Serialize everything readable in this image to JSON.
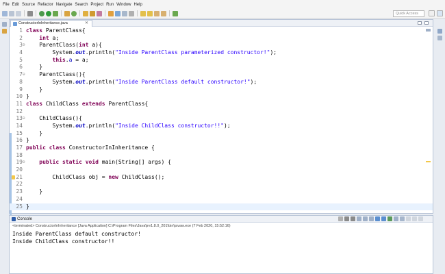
{
  "menu": [
    "File",
    "Edit",
    "Source",
    "Refactor",
    "Navigate",
    "Search",
    "Project",
    "Run",
    "Window",
    "Help"
  ],
  "toolbar": {
    "quick_access": "Quick Access"
  },
  "editor": {
    "tab_label": "ConstructorInInheritance.java",
    "lines": [
      {
        "n": "1",
        "fold": ""
      },
      {
        "n": "2",
        "fold": ""
      },
      {
        "n": "3",
        "fold": "⊖"
      },
      {
        "n": "4",
        "fold": ""
      },
      {
        "n": "5",
        "fold": ""
      },
      {
        "n": "6",
        "fold": ""
      },
      {
        "n": "7",
        "fold": "⊖"
      },
      {
        "n": "8",
        "fold": ""
      },
      {
        "n": "9",
        "fold": ""
      },
      {
        "n": "10",
        "fold": ""
      },
      {
        "n": "11",
        "fold": ""
      },
      {
        "n": "12",
        "fold": ""
      },
      {
        "n": "13",
        "fold": "⊖"
      },
      {
        "n": "14",
        "fold": ""
      },
      {
        "n": "15",
        "fold": ""
      },
      {
        "n": "16",
        "fold": ""
      },
      {
        "n": "17",
        "fold": ""
      },
      {
        "n": "18",
        "fold": ""
      },
      {
        "n": "19",
        "fold": "⊖"
      },
      {
        "n": "20",
        "fold": ""
      },
      {
        "n": "21",
        "fold": ""
      },
      {
        "n": "22",
        "fold": ""
      },
      {
        "n": "23",
        "fold": ""
      },
      {
        "n": "24",
        "fold": ""
      },
      {
        "n": "25",
        "fold": ""
      }
    ],
    "code": {
      "l1_kw": "class",
      "l1_rest": " ParentClass{",
      "l2_kw": "int",
      "l2_rest": " a;",
      "l3_name": "ParentClass(",
      "l3_kw": "int",
      "l3_rest": " a){",
      "l4_pre": "System.",
      "l4_fld": "out",
      "l4_mid": ".println(",
      "l4_str": "\"Inside ParentClass parameterized constructor!\"",
      "l4_end": ");",
      "l5_kw": "this",
      "l5_dot": ".",
      "l5_fld": "a",
      "l5_rest": " = a;",
      "l6": "}",
      "l7": "ParentClass(){",
      "l8_pre": "System.",
      "l8_fld": "out",
      "l8_mid": ".println(",
      "l8_str": "\"Inside ParentClass default constructor!\"",
      "l8_end": ");",
      "l9": "}",
      "l10": "}",
      "l11_kw": "class",
      "l11_mid": " ChildClass ",
      "l11_kw2": "extends",
      "l11_rest": " ParentClass{",
      "l13": "ChildClass(){",
      "l14_pre": "System.",
      "l14_fld": "out",
      "l14_mid": ".println(",
      "l14_str": "\"Inside ChildClass constructor!!\"",
      "l14_end": ");",
      "l15": "}",
      "l16": "}",
      "l17_kw": "public class",
      "l17_rest": " ConstructorInInheritance {",
      "l19_kw": "public static void",
      "l19_rest": " main(String[] args) {",
      "l21_pre": "ChildClass obj = ",
      "l21_kw": "new",
      "l21_rest": " ChildClass();",
      "l23": "}",
      "l25": "}"
    }
  },
  "console": {
    "title": "Console",
    "terminated": "<terminated> ConstructorInInheritance [Java Application] C:\\Program Files\\Java\\jre1.8.0_201\\bin\\javaw.exe (7 Feb 2020, 15:52:16)",
    "output": [
      "Inside ParentClass default constructor!",
      "Inside ChildClass constructor!!"
    ]
  },
  "colors": {
    "keyword": "#7f0055",
    "string": "#2a00ff",
    "field": "#0000c0",
    "current_line": "#e8f2fe"
  }
}
